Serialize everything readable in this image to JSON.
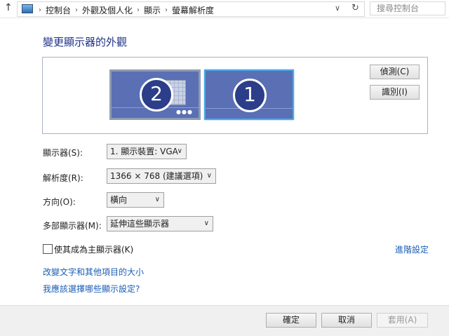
{
  "address_bar": {
    "breadcrumbs": [
      "控制台",
      "外觀及個人化",
      "顯示",
      "螢幕解析度"
    ],
    "search_placeholder": "搜尋控制台"
  },
  "title": "變更顯示器的外觀",
  "preview": {
    "monitor_2_label": "2",
    "monitor_1_label": "1",
    "detect_button": "偵測(C)",
    "identify_button": "識別(I)"
  },
  "form": {
    "display_label": "顯示器(S):",
    "display_value": "1. 顯示裝置: VGA",
    "resolution_label": "解析度(R):",
    "resolution_value": "1366 × 768 (建議選項)",
    "orientation_label": "方向(O):",
    "orientation_value": "橫向",
    "multi_label": "多部顯示器(M):",
    "multi_value": "延伸這些顯示器"
  },
  "primary_checkbox": {
    "label": "使其成為主顯示器(K)",
    "checked": false
  },
  "links": {
    "advanced": "進階設定",
    "text_size": "改變文字和其他項目的大小",
    "which_settings": "我應該選擇哪些顯示設定?"
  },
  "buttons": {
    "ok": "確定",
    "cancel": "取消",
    "apply": "套用(A)"
  }
}
